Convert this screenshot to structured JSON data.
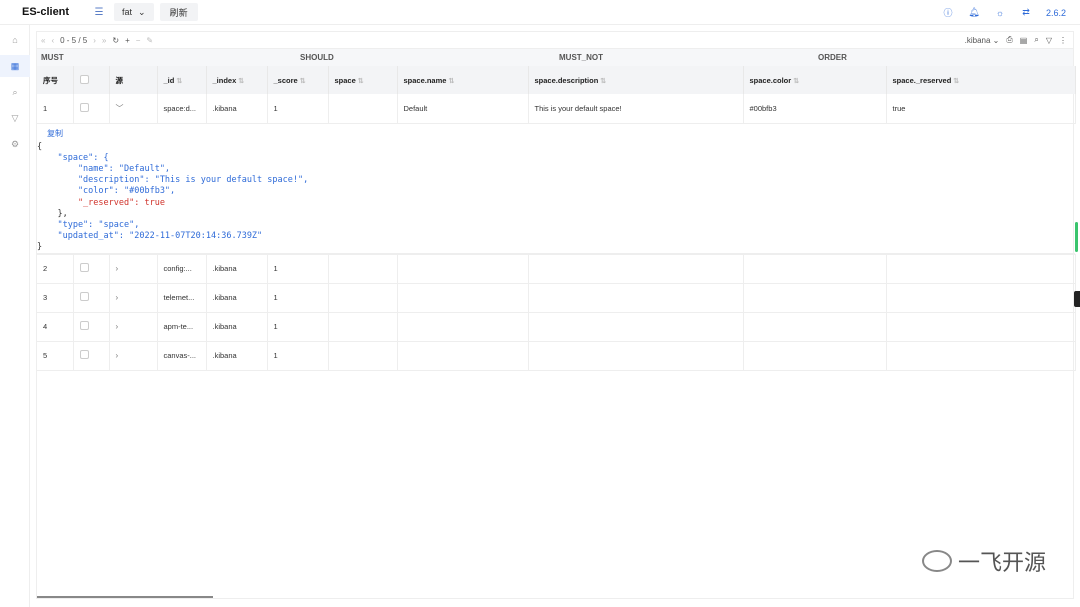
{
  "header": {
    "app_title": "ES-client",
    "env_value": "fat",
    "refresh_label": "刷新",
    "version": "2.6.2"
  },
  "toolbar": {
    "range": "0 - 5 / 5",
    "index_value": ".kibana"
  },
  "query": {
    "must": "MUST",
    "should": "SHOULD",
    "must_not": "MUST_NOT",
    "order": "ORDER"
  },
  "table": {
    "headers": [
      "序号",
      "",
      "源",
      "_id",
      "_index",
      "_score",
      "space",
      "space.name",
      "space.description",
      "space.color",
      "space._reserved"
    ],
    "rows": [
      {
        "no": "1",
        "id": "space:d...",
        "index": ".kibana",
        "score": "1",
        "space": "",
        "name": "Default",
        "description": "This is your default space!",
        "color": "#00bfb3",
        "reserved": "true"
      },
      {
        "no": "2",
        "id": "config:...",
        "index": ".kibana",
        "score": "1",
        "space": "",
        "name": "",
        "description": "",
        "color": "",
        "reserved": ""
      },
      {
        "no": "3",
        "id": "telemet...",
        "index": ".kibana",
        "score": "1",
        "space": "",
        "name": "",
        "description": "",
        "color": "",
        "reserved": ""
      },
      {
        "no": "4",
        "id": "apm-te...",
        "index": ".kibana",
        "score": "1",
        "space": "",
        "name": "",
        "description": "",
        "color": "",
        "reserved": ""
      },
      {
        "no": "5",
        "id": "canvas-...",
        "index": ".kibana",
        "score": "1",
        "space": "",
        "name": "",
        "description": "",
        "color": "",
        "reserved": ""
      }
    ]
  },
  "detail": {
    "copy_label": "复制",
    "json_lines": [
      "{",
      "    \"space\": {",
      "        \"name\": \"Default\",",
      "        \"description\": \"This is your default space!\",",
      "        \"color\": \"#00bfb3\",",
      "        \"_reserved\": true",
      "    },",
      "    \"type\": \"space\",",
      "    \"updated_at\": \"2022-11-07T20:14:36.739Z\"",
      "}"
    ]
  },
  "watermark": "一飞开源",
  "colors": {
    "accent": "#2f6bd8",
    "bool": "#d0342c",
    "scroll_indicator": "#3ac46d"
  }
}
